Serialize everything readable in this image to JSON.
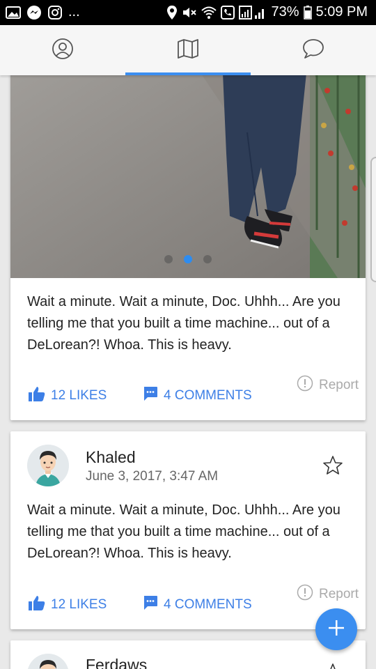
{
  "status_bar": {
    "battery": "73%",
    "time": "5:09 PM",
    "overflow": "...",
    "left_icons": [
      "gallery-icon",
      "messenger-icon",
      "instagram-icon"
    ],
    "right_icons": [
      "location-icon",
      "mute-icon",
      "wifi-icon",
      "call-icon",
      "signal-icon",
      "battery-icon"
    ]
  },
  "nav": {
    "tabs": [
      {
        "name": "profile",
        "icon": "person-icon"
      },
      {
        "name": "map",
        "icon": "map-icon",
        "active": true
      },
      {
        "name": "chat",
        "icon": "chat-icon"
      }
    ],
    "accent": "#3b8ef0"
  },
  "posts": [
    {
      "text": "Wait a minute. Wait a minute, Doc. Uhhh... Are you telling me that you built a time machine... out of a DeLorean?! Whoa. This is heavy.",
      "likes_label": "12 LIKES",
      "comments_label": "4 COMMENTS",
      "report_label": "Report",
      "carousel": {
        "count": 3,
        "active": 2
      }
    },
    {
      "author": "Khaled",
      "date": "June 3, 2017, 3:47 AM",
      "text": "Wait a minute. Wait a minute, Doc. Uhhh... Are you telling me that you built a time machine... out of a DeLorean?! Whoa. This is heavy.",
      "likes_label": "12 LIKES",
      "comments_label": "4 COMMENTS",
      "report_label": "Report"
    },
    {
      "author": "Ferdaws"
    }
  ],
  "colors": {
    "link": "#3d7fe6",
    "muted": "#aaaaaa",
    "fab": "#3b8ef0"
  }
}
